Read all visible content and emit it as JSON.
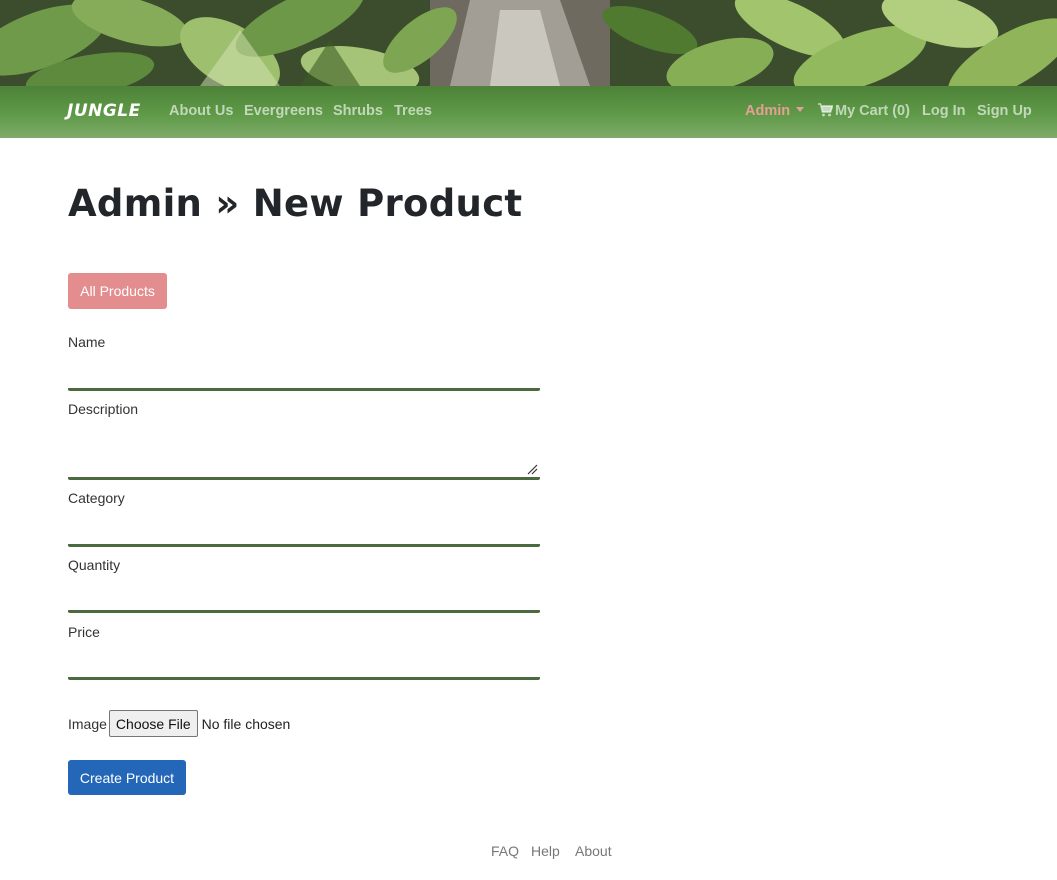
{
  "navbar": {
    "brand": "JUNGLE",
    "links": [
      "About Us",
      "Evergreens",
      "Shrubs",
      "Trees"
    ],
    "admin_label": "Admin",
    "cart_label": "My Cart (0)",
    "login_label": "Log In",
    "signup_label": "Sign Up",
    "admin_color": "#e59f95"
  },
  "page": {
    "title": "Admin » New Product",
    "all_products_label": "All Products"
  },
  "form": {
    "name_label": "Name",
    "description_label": "Description",
    "category_label": "Category",
    "quantity_label": "Quantity",
    "price_label": "Price",
    "image_label": "Image",
    "file_button_label": "Choose File",
    "file_status": "No file chosen",
    "submit_label": "Create Product"
  },
  "footer": {
    "links": [
      "FAQ",
      "Help",
      "About"
    ]
  },
  "colors": {
    "navbar": "#5f9a48",
    "all_products_button": "#e38d8f",
    "create_button": "#2467b9",
    "field_underline": "#4b6a40"
  }
}
